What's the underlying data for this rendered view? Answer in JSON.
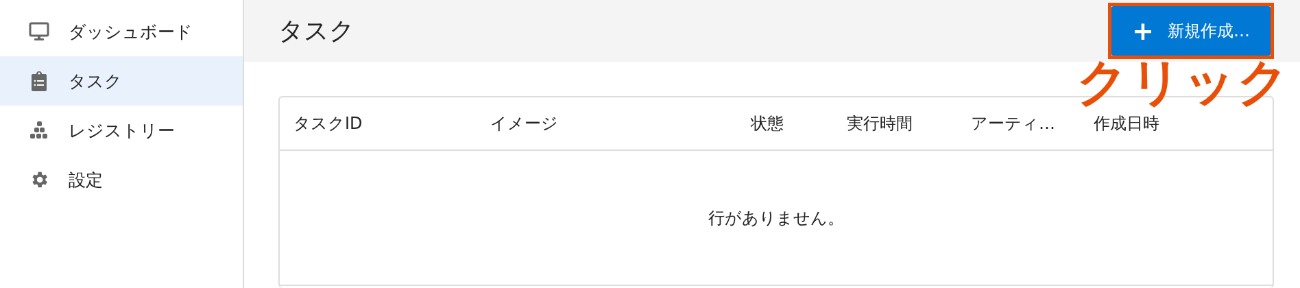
{
  "sidebar": {
    "items": [
      {
        "label": "ダッシュボード",
        "selected": false
      },
      {
        "label": "タスク",
        "selected": true
      },
      {
        "label": "レジストリー",
        "selected": false
      },
      {
        "label": "設定",
        "selected": false
      }
    ]
  },
  "header": {
    "title": "タスク",
    "button": {
      "icon": "+",
      "label": "新規作成…"
    }
  },
  "annotation": {
    "text": "クリック"
  },
  "table": {
    "columns": [
      "タスクID",
      "イメージ",
      "状態",
      "実行時間",
      "アーティ…",
      "作成日時"
    ],
    "empty_message": "行がありません。"
  }
}
